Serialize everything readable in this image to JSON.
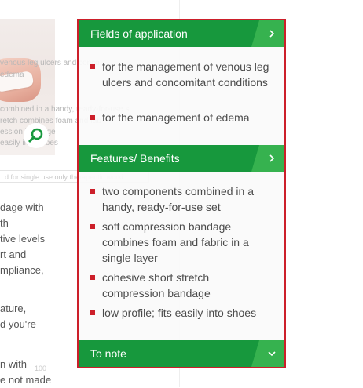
{
  "background": {
    "faded_lines": [
      "venous leg ulcers and conco",
      "edema",
      "combined in a handy, ready-for-use s",
      "retch combines foam and fab",
      "ession bandage",
      "easily into shoes"
    ],
    "input_text": "d for single use only therapeutic worki",
    "text_lines_1": [
      "dage with",
      "th",
      "tive levels",
      "rt and",
      "mpliance,"
    ],
    "text_lines_2": [
      "ature,",
      "d you're"
    ],
    "text_lines_3": [
      "n with",
      "e not made"
    ],
    "quantity_value": "100"
  },
  "accordion": {
    "sections": [
      {
        "title": "Fields of application",
        "icon": "chevron-right-icon",
        "items": [
          "for the management of venous leg ulcers and concomitant conditions",
          "for the management of edema"
        ]
      },
      {
        "title": "Features/ Benefits",
        "icon": "chevron-right-icon",
        "items": [
          "two components combined in a handy, ready-for-use set",
          "soft compression bandage combines foam and fabric in a single layer",
          "cohesive short stretch compression bandage",
          "low profile; fits easily into shoes"
        ]
      },
      {
        "title": "To note",
        "icon": "chevron-down-icon"
      }
    ]
  },
  "colors": {
    "header_green": "#17983d",
    "header_green_light": "#36b24f",
    "border_red": "#cc1f2a",
    "bullet_red": "#cc1f2a"
  }
}
